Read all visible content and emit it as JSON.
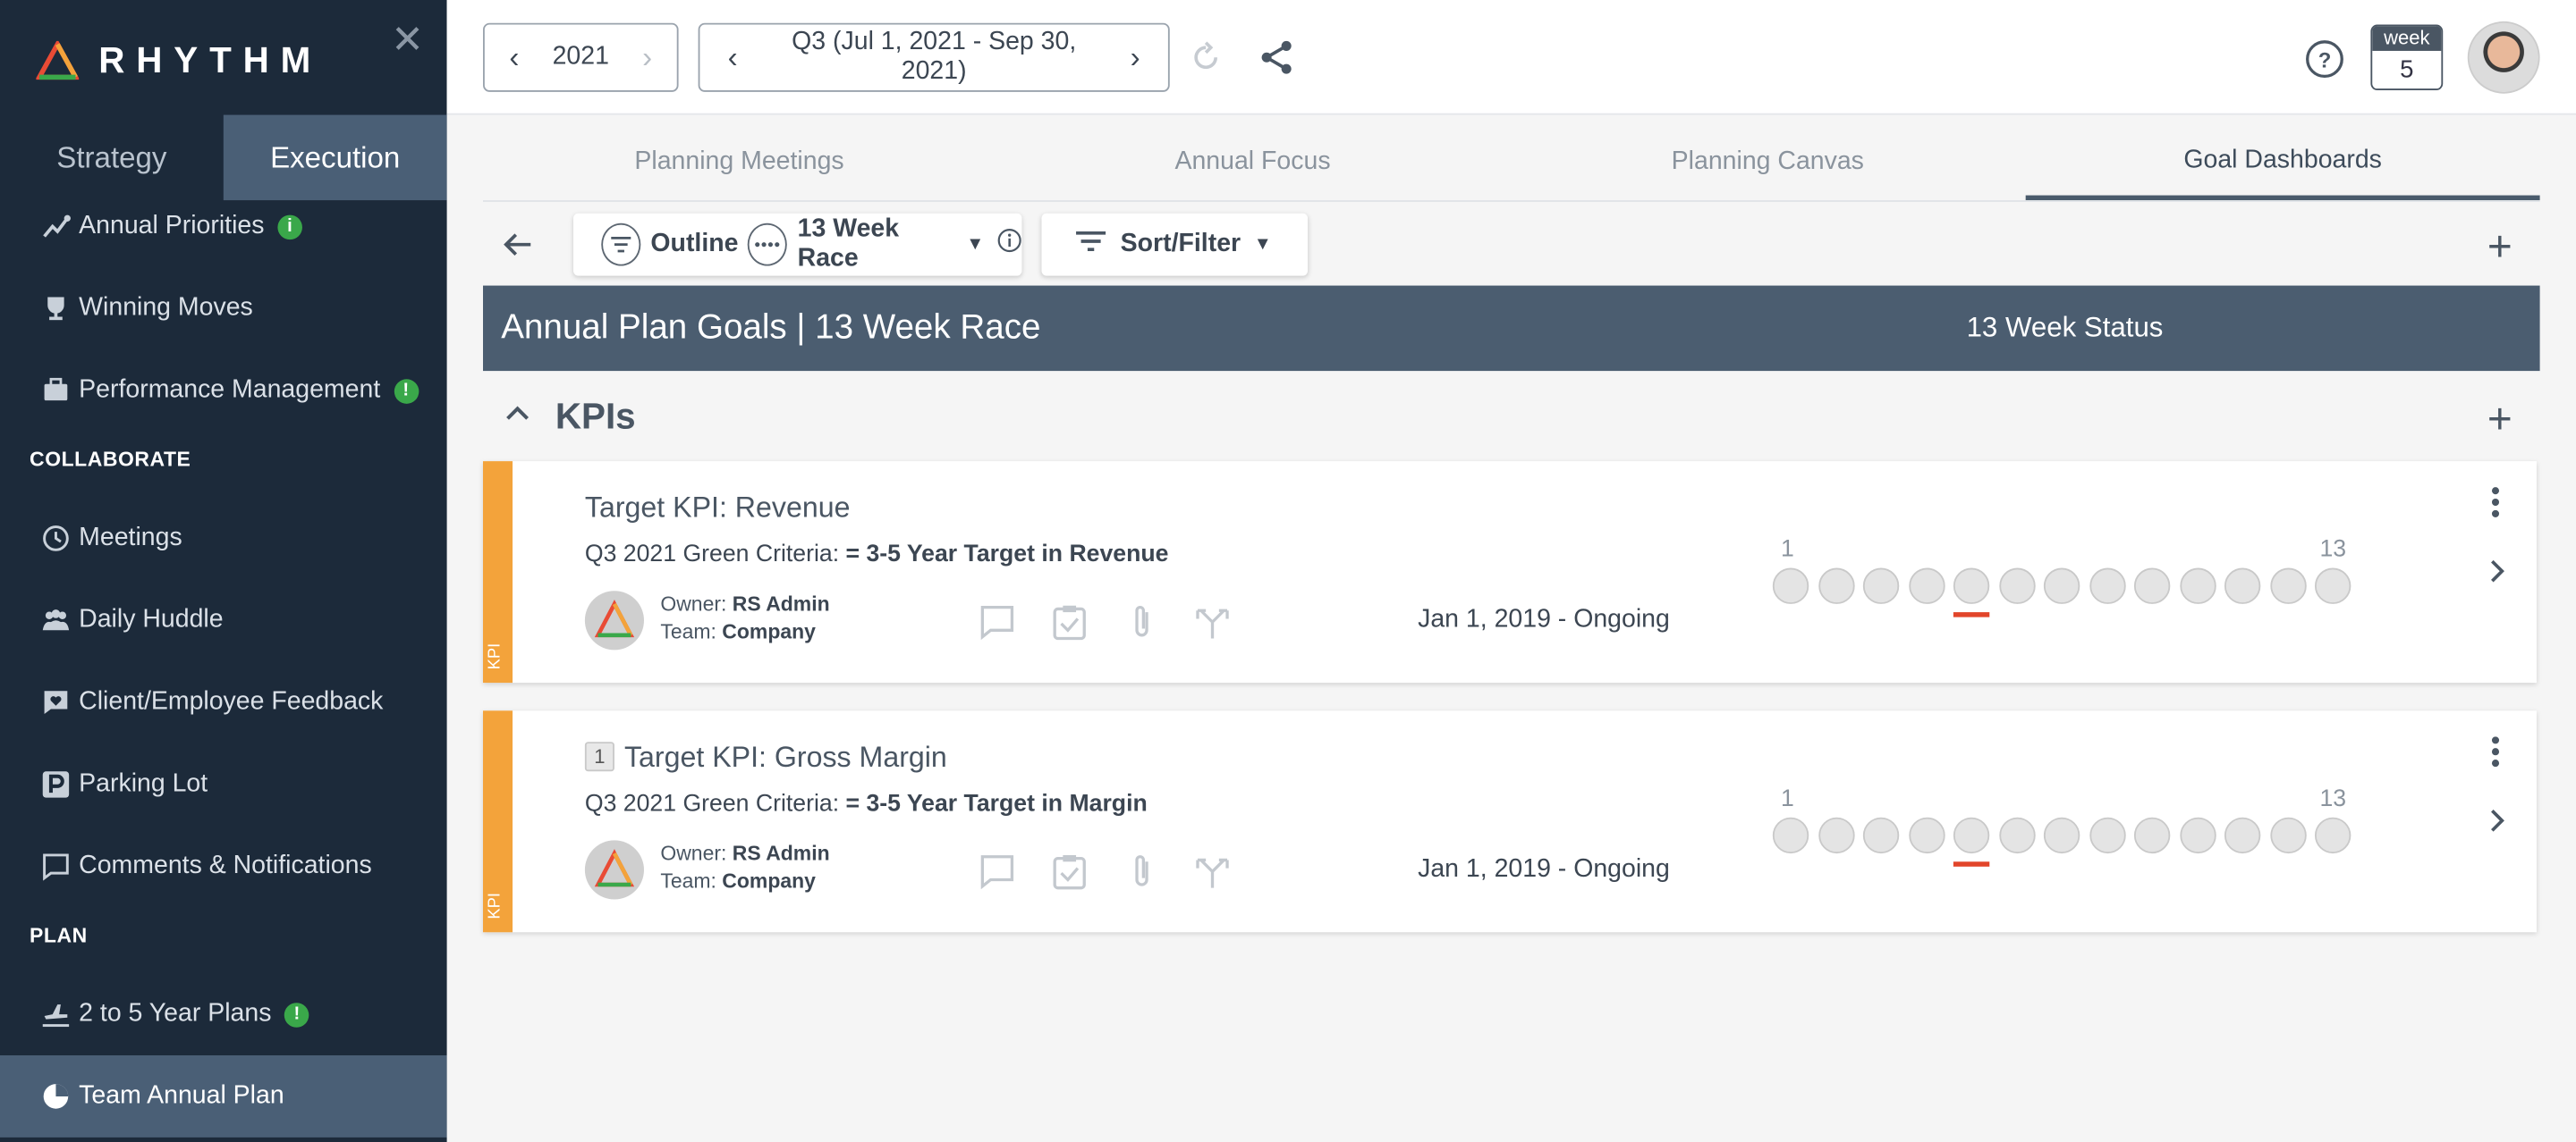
{
  "app": {
    "name": "RHYTHM"
  },
  "sidebar": {
    "modes": [
      "Strategy",
      "Execution"
    ],
    "items_top": [
      {
        "label": "Annual Priorities",
        "badge": "i"
      },
      {
        "label": "Winning Moves"
      },
      {
        "label": "Performance Management",
        "badge": "!"
      }
    ],
    "collaborate_title": "COLLABORATE",
    "collaborate": [
      {
        "label": "Meetings"
      },
      {
        "label": "Daily Huddle"
      },
      {
        "label": "Client/Employee Feedback"
      },
      {
        "label": "Parking Lot"
      },
      {
        "label": "Comments & Notifications"
      }
    ],
    "plan_title": "PLAN",
    "plan": [
      {
        "label": "2 to 5 Year Plans",
        "badge": "!"
      },
      {
        "label": "Team Annual Plan"
      }
    ]
  },
  "topbar": {
    "year": "2021",
    "quarter": "Q3 (Jul 1, 2021 - Sep 30, 2021)",
    "week_label": "week",
    "week_number": "5"
  },
  "tabs": [
    "Planning Meetings",
    "Annual Focus",
    "Planning Canvas",
    "Goal Dashboards"
  ],
  "toolbar": {
    "outline": "Outline",
    "race": "13 Week Race",
    "sort": "Sort/Filter"
  },
  "header": {
    "title": "Annual Plan Goals | 13 Week Race",
    "status": "13 Week Status"
  },
  "section": {
    "title": "KPIs"
  },
  "cards": [
    {
      "tag": "KPI",
      "number": "",
      "title": "Target KPI: Revenue",
      "criteria_label": "Q3 2021 Green Criteria:",
      "criteria_value": "= 3-5 Year Target in Revenue",
      "owner_label": "Owner:",
      "owner": "RS Admin",
      "team_label": "Team:",
      "team": "Company",
      "dates": "Jan 1, 2019 - Ongoing",
      "week_start": "1",
      "week_end": "13",
      "current_week": 5
    },
    {
      "tag": "KPI",
      "number": "1",
      "title": "Target KPI: Gross Margin",
      "criteria_label": "Q3 2021 Green Criteria:",
      "criteria_value": "= 3-5 Year Target in Margin",
      "owner_label": "Owner:",
      "owner": "RS Admin",
      "team_label": "Team:",
      "team": "Company",
      "dates": "Jan 1, 2019 - Ongoing",
      "week_start": "1",
      "week_end": "13",
      "current_week": 5
    }
  ],
  "colors": {
    "sidebar": "#1c2a3a",
    "active": "#4a5f76",
    "header": "#4b5d70",
    "kpi_stripe": "#f3a33b",
    "current_week_marker": "#e2452a",
    "badge": "#3aa84a"
  }
}
